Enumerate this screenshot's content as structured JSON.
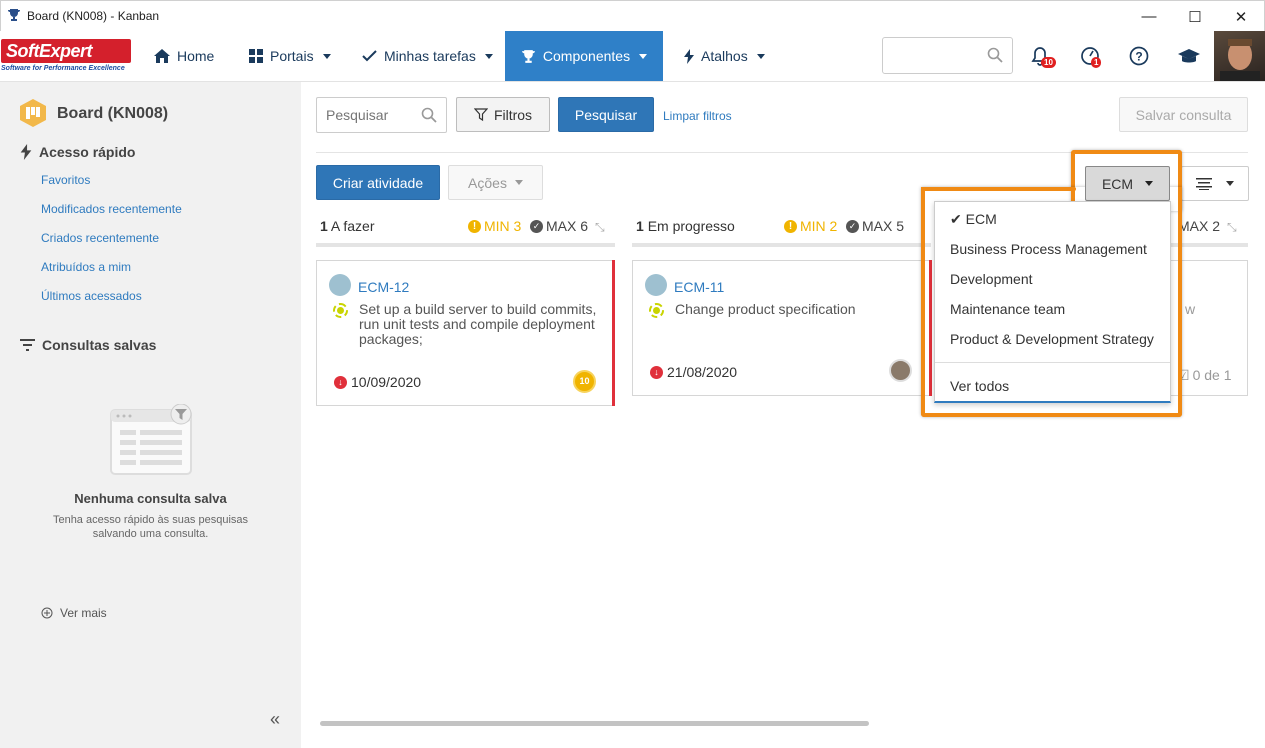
{
  "window": {
    "title": "Board (KN008) - Kanban",
    "minimize": "—",
    "maximize": "☐",
    "close": "✕"
  },
  "logo": {
    "brand": "SoftExpert",
    "tagline": "Software for Performance Excellence"
  },
  "nav": {
    "items": [
      {
        "label": "Home",
        "icon": "home-icon"
      },
      {
        "label": "Portais",
        "icon": "grid-icon",
        "has_caret": true
      },
      {
        "label": "Minhas tarefas",
        "icon": "check-icon",
        "has_caret": true
      },
      {
        "label": "Componentes",
        "icon": "trophy-icon",
        "has_caret": true,
        "active": true
      },
      {
        "label": "Atalhos",
        "icon": "bolt-icon",
        "has_caret": true
      }
    ],
    "notifications_count": "10",
    "activity_count": "1"
  },
  "sidebar": {
    "board_title": "Board (KN008)",
    "quick_access": {
      "heading": "Acesso rápido",
      "links": [
        "Favoritos",
        "Modificados recentemente",
        "Criados recentemente",
        "Atribuídos a mim",
        "Últimos acessados"
      ]
    },
    "saved_queries": {
      "heading": "Consultas salvas",
      "empty_title": "Nenhuma consulta salva",
      "empty_desc": "Tenha acesso rápido às suas pesquisas salvando uma consulta."
    },
    "see_more": "Ver mais",
    "collapse": "«"
  },
  "toolbar": {
    "search_placeholder": "Pesquisar",
    "filters_label": "Filtros",
    "search_button": "Pesquisar",
    "clear_filters": "Limpar filtros",
    "save_query": "Salvar consulta",
    "create_activity": "Criar atividade",
    "actions": "Ações",
    "board_selector": "ECM"
  },
  "columns": [
    {
      "count": "1",
      "name": "A fazer",
      "min": "MIN 3",
      "max": "MAX 6"
    },
    {
      "count": "1",
      "name": "Em progresso",
      "min": "MIN 2",
      "max": "MAX 5"
    },
    {
      "max": "MAX 2"
    }
  ],
  "cards": [
    {
      "id": "ECM-12",
      "description": "Set up a build server to build commits, run unit tests and compile deployment packages;",
      "date": "10/09/2020",
      "priority": "10"
    },
    {
      "id": "ECM-11",
      "description": "Change product specification",
      "date": "21/08/2020"
    },
    {
      "description_fragment": "w",
      "checklist": "0 de 1"
    }
  ],
  "dropdown": {
    "items": [
      {
        "label": "ECM",
        "checked": true
      },
      {
        "label": "Business Process Management"
      },
      {
        "label": "Development"
      },
      {
        "label": "Maintenance team"
      },
      {
        "label": "Product & Development Strategy"
      }
    ],
    "see_all": "Ver todos"
  },
  "colors": {
    "accent": "#2f80c8",
    "primary_button": "#2f76b7",
    "highlight": "#f08a14",
    "overdue": "#e0303b",
    "warning": "#f0b400"
  }
}
